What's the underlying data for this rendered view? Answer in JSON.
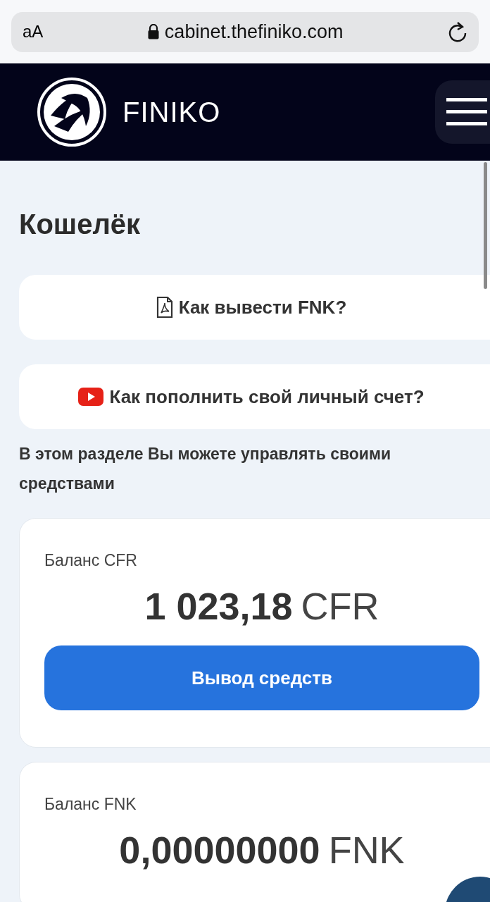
{
  "browser": {
    "text_size": "aA",
    "url": "cabinet.thefiniko.com"
  },
  "header": {
    "brand": "FINIKO"
  },
  "page": {
    "title": "Кошелёк",
    "guides": [
      {
        "kind": "pdf",
        "label": "Как вывести FNK?"
      },
      {
        "kind": "video",
        "label": "Как пополнить свой личный счет?"
      }
    ],
    "description": "В этом разделе Вы можете управлять своими средствами",
    "balances": [
      {
        "label": "Баланс CFR",
        "amount": "1 023,18",
        "currency": "CFR",
        "button": "Вывод средств"
      },
      {
        "label": "Баланс FNK",
        "amount": "0,00000000",
        "currency": "FNK"
      }
    ]
  }
}
